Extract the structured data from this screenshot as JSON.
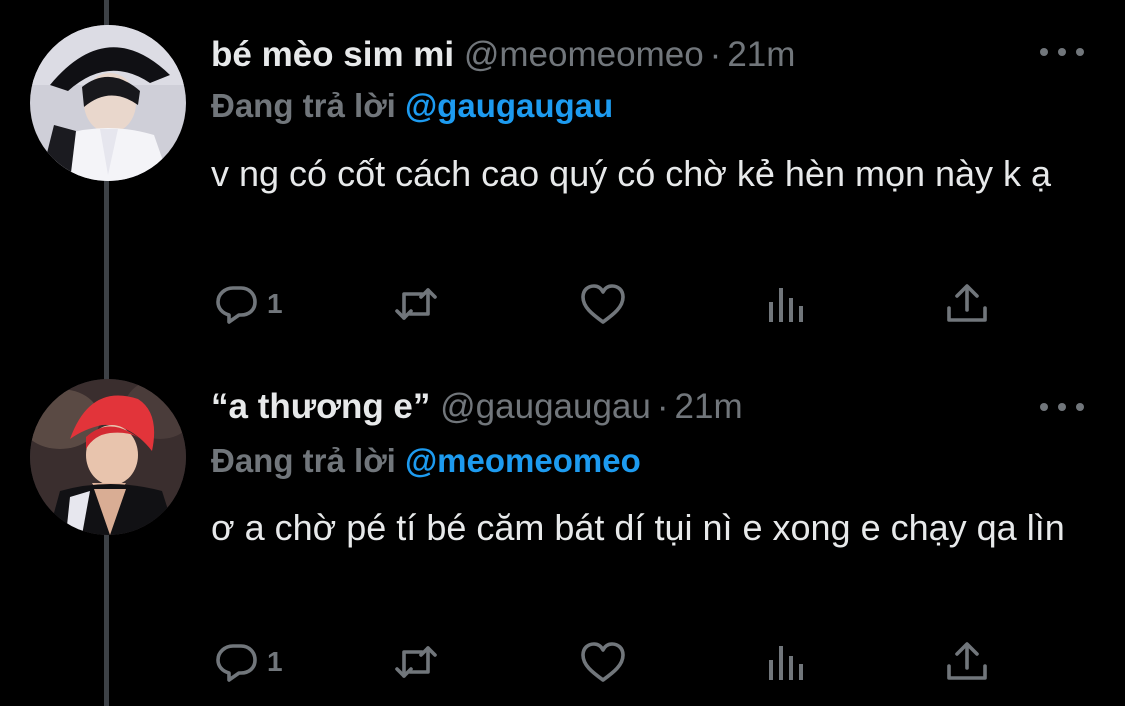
{
  "colors": {
    "background": "#000000",
    "primary_text": "#e7e9ea",
    "secondary_text": "#71767b",
    "mention": "#1d9bf0",
    "thread_line": "#3d4146"
  },
  "tweets": [
    {
      "display_name": "bé mèo sim mi",
      "handle": "@meomeomeo",
      "separator": "·",
      "time": "21m",
      "reply_prefix": "Đang trả lời",
      "reply_to": "@gaugaugau",
      "text": "v ng có cốt cách cao quý có chờ kẻ hèn mọn này k ạ",
      "reply_count": "1",
      "icons": {
        "avatar": "avatar-photo",
        "more": "more-icon",
        "reply": "reply-icon",
        "retweet": "retweet-icon",
        "like": "heart-icon",
        "analytics": "analytics-icon",
        "share": "share-icon"
      }
    },
    {
      "display_name": "“a thương e”",
      "handle": "@gaugaugau",
      "separator": "·",
      "time": "21m",
      "reply_prefix": "Đang trả lời",
      "reply_to": "@meomeomeo",
      "text": "ơ a chờ pé tí bé căm bát dí tụi nì e xong e chạy qa lìn",
      "reply_count": "1",
      "icons": {
        "avatar": "avatar-photo",
        "more": "more-icon",
        "reply": "reply-icon",
        "retweet": "retweet-icon",
        "like": "heart-icon",
        "analytics": "analytics-icon",
        "share": "share-icon"
      }
    }
  ]
}
